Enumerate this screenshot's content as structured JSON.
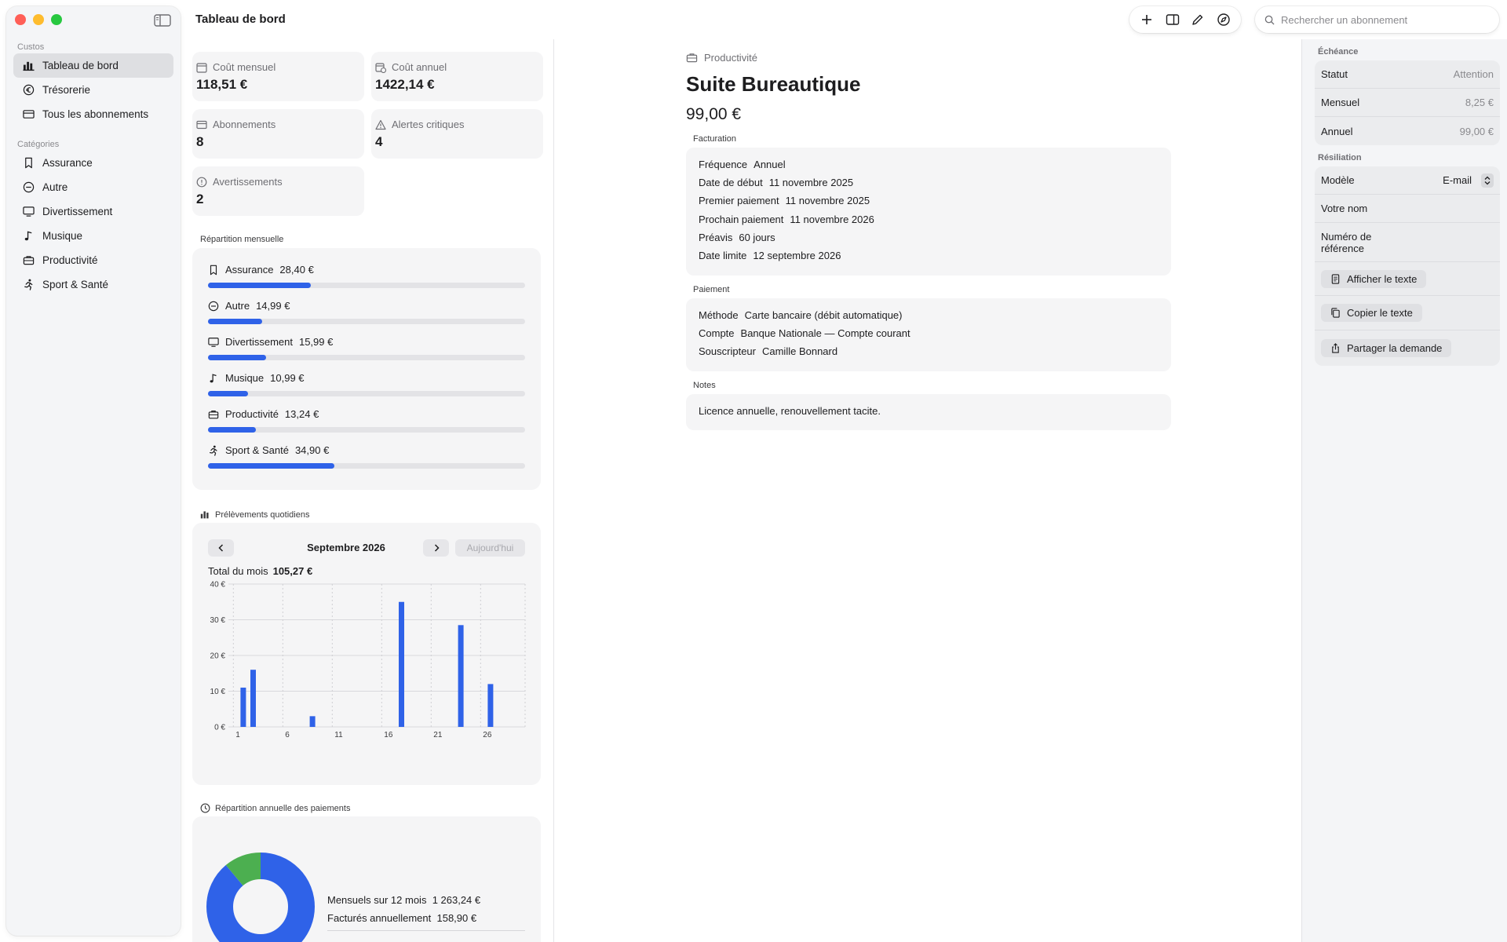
{
  "window": {
    "title": "Tableau de bord",
    "search_placeholder": "Rechercher un abonnement"
  },
  "sidebar": {
    "section_main": "Custos",
    "main_items": [
      {
        "label": "Tableau de bord",
        "icon": "chart-icon",
        "active": true
      },
      {
        "label": "Trésorerie",
        "icon": "euro-circle-icon"
      },
      {
        "label": "Tous les abonnements",
        "icon": "card-icon"
      }
    ],
    "section_categories": "Catégories",
    "category_items": [
      {
        "label": "Assurance",
        "icon": "bookmark-icon"
      },
      {
        "label": "Autre",
        "icon": "minus-circle-icon"
      },
      {
        "label": "Divertissement",
        "icon": "tv-icon"
      },
      {
        "label": "Musique",
        "icon": "music-note-icon"
      },
      {
        "label": "Productivité",
        "icon": "briefcase-icon"
      },
      {
        "label": "Sport & Santé",
        "icon": "runner-icon"
      }
    ]
  },
  "stats": [
    {
      "label": "Coût mensuel",
      "value": "118,51 €",
      "icon": "calendar-icon"
    },
    {
      "label": "Coût annuel",
      "value": "1422,14 €",
      "icon": "calendar-clock-icon"
    },
    {
      "label": "Abonnements",
      "value": "8",
      "icon": "card-icon"
    },
    {
      "label": "Alertes critiques",
      "value": "4",
      "icon": "warning-icon"
    },
    {
      "label": "Avertissements",
      "value": "2",
      "icon": "info-circle-icon"
    }
  ],
  "monthly_breakdown": {
    "title": "Répartition mensuelle",
    "items": [
      {
        "label": "Assurance",
        "amount": "28,40 €",
        "share": 0.24,
        "icon": "bookmark-icon"
      },
      {
        "label": "Autre",
        "amount": "14,99 €",
        "share": 0.126,
        "icon": "minus-circle-icon"
      },
      {
        "label": "Divertissement",
        "amount": "15,99 €",
        "share": 0.135,
        "icon": "tv-icon"
      },
      {
        "label": "Musique",
        "amount": "10,99 €",
        "share": 0.093,
        "icon": "music-note-icon"
      },
      {
        "label": "Productivité",
        "amount": "13,24 €",
        "share": 0.112,
        "icon": "briefcase-icon"
      },
      {
        "label": "Sport & Santé",
        "amount": "34,90 €",
        "share": 0.294,
        "icon": "runner-icon"
      }
    ]
  },
  "daily": {
    "title": "Prélèvements quotidiens",
    "month": "Septembre 2026",
    "today_label": "Aujourd'hui",
    "total_label": "Total du mois",
    "total_value": "105,27 €"
  },
  "chart_data": {
    "type": "bar",
    "x": [
      2,
      3,
      9,
      18,
      24,
      27
    ],
    "values": [
      11,
      16,
      3,
      35,
      28.5,
      12
    ],
    "xlim": [
      0.5,
      30.5
    ],
    "ylim": [
      0,
      40
    ],
    "xticks": [
      1,
      6,
      11,
      16,
      21,
      26
    ],
    "yticks": [
      0,
      10,
      20,
      30,
      40
    ],
    "ytick_labels": [
      "0 €",
      "10 €",
      "20 €",
      "30 €",
      "40 €"
    ],
    "grid": true,
    "color": "#2f62e8"
  },
  "annual_split": {
    "title": "Répartition annuelle des paiements",
    "rows": [
      {
        "label": "Mensuels sur 12 mois",
        "value": "1 263,24 €"
      },
      {
        "label": "Facturés annuellement",
        "value": "158,90 €"
      }
    ],
    "donut": [
      {
        "value": 1263.24,
        "color": "#2f62e8"
      },
      {
        "value": 158.9,
        "color": "#4caf50"
      }
    ]
  },
  "detail": {
    "category": "Productivité",
    "name": "Suite Bureautique",
    "price": "99,00 €",
    "billing_title": "Facturation",
    "billing": [
      {
        "k": "Fréquence",
        "v": "Annuel"
      },
      {
        "k": "Date de début",
        "v": "11 novembre 2025"
      },
      {
        "k": "Premier paiement",
        "v": "11 novembre 2025"
      },
      {
        "k": "Prochain paiement",
        "v": "11 novembre 2026"
      },
      {
        "k": "Préavis",
        "v": "60 jours"
      },
      {
        "k": "Date limite",
        "v": "12 septembre 2026"
      }
    ],
    "payment_title": "Paiement",
    "payment": [
      {
        "k": "Méthode",
        "v": "Carte bancaire (débit automatique)"
      },
      {
        "k": "Compte",
        "v": "Banque Nationale — Compte courant"
      },
      {
        "k": "Souscripteur",
        "v": "Camille Bonnard"
      }
    ],
    "notes_title": "Notes",
    "notes": "Licence annuelle, renouvellement tacite."
  },
  "inspector": {
    "due_title": "Échéance",
    "due_rows": [
      {
        "k": "Statut",
        "v": "Attention"
      },
      {
        "k": "Mensuel",
        "v": "8,25 €"
      },
      {
        "k": "Annuel",
        "v": "99,00 €"
      }
    ],
    "cancel_title": "Résiliation",
    "model_label": "Modèle",
    "model_value": "E-mail",
    "name_label": "Votre nom",
    "ref_label": "Numéro de référence",
    "btn_show": "Afficher le texte",
    "btn_copy": "Copier le texte",
    "btn_share": "Partager la demande"
  }
}
